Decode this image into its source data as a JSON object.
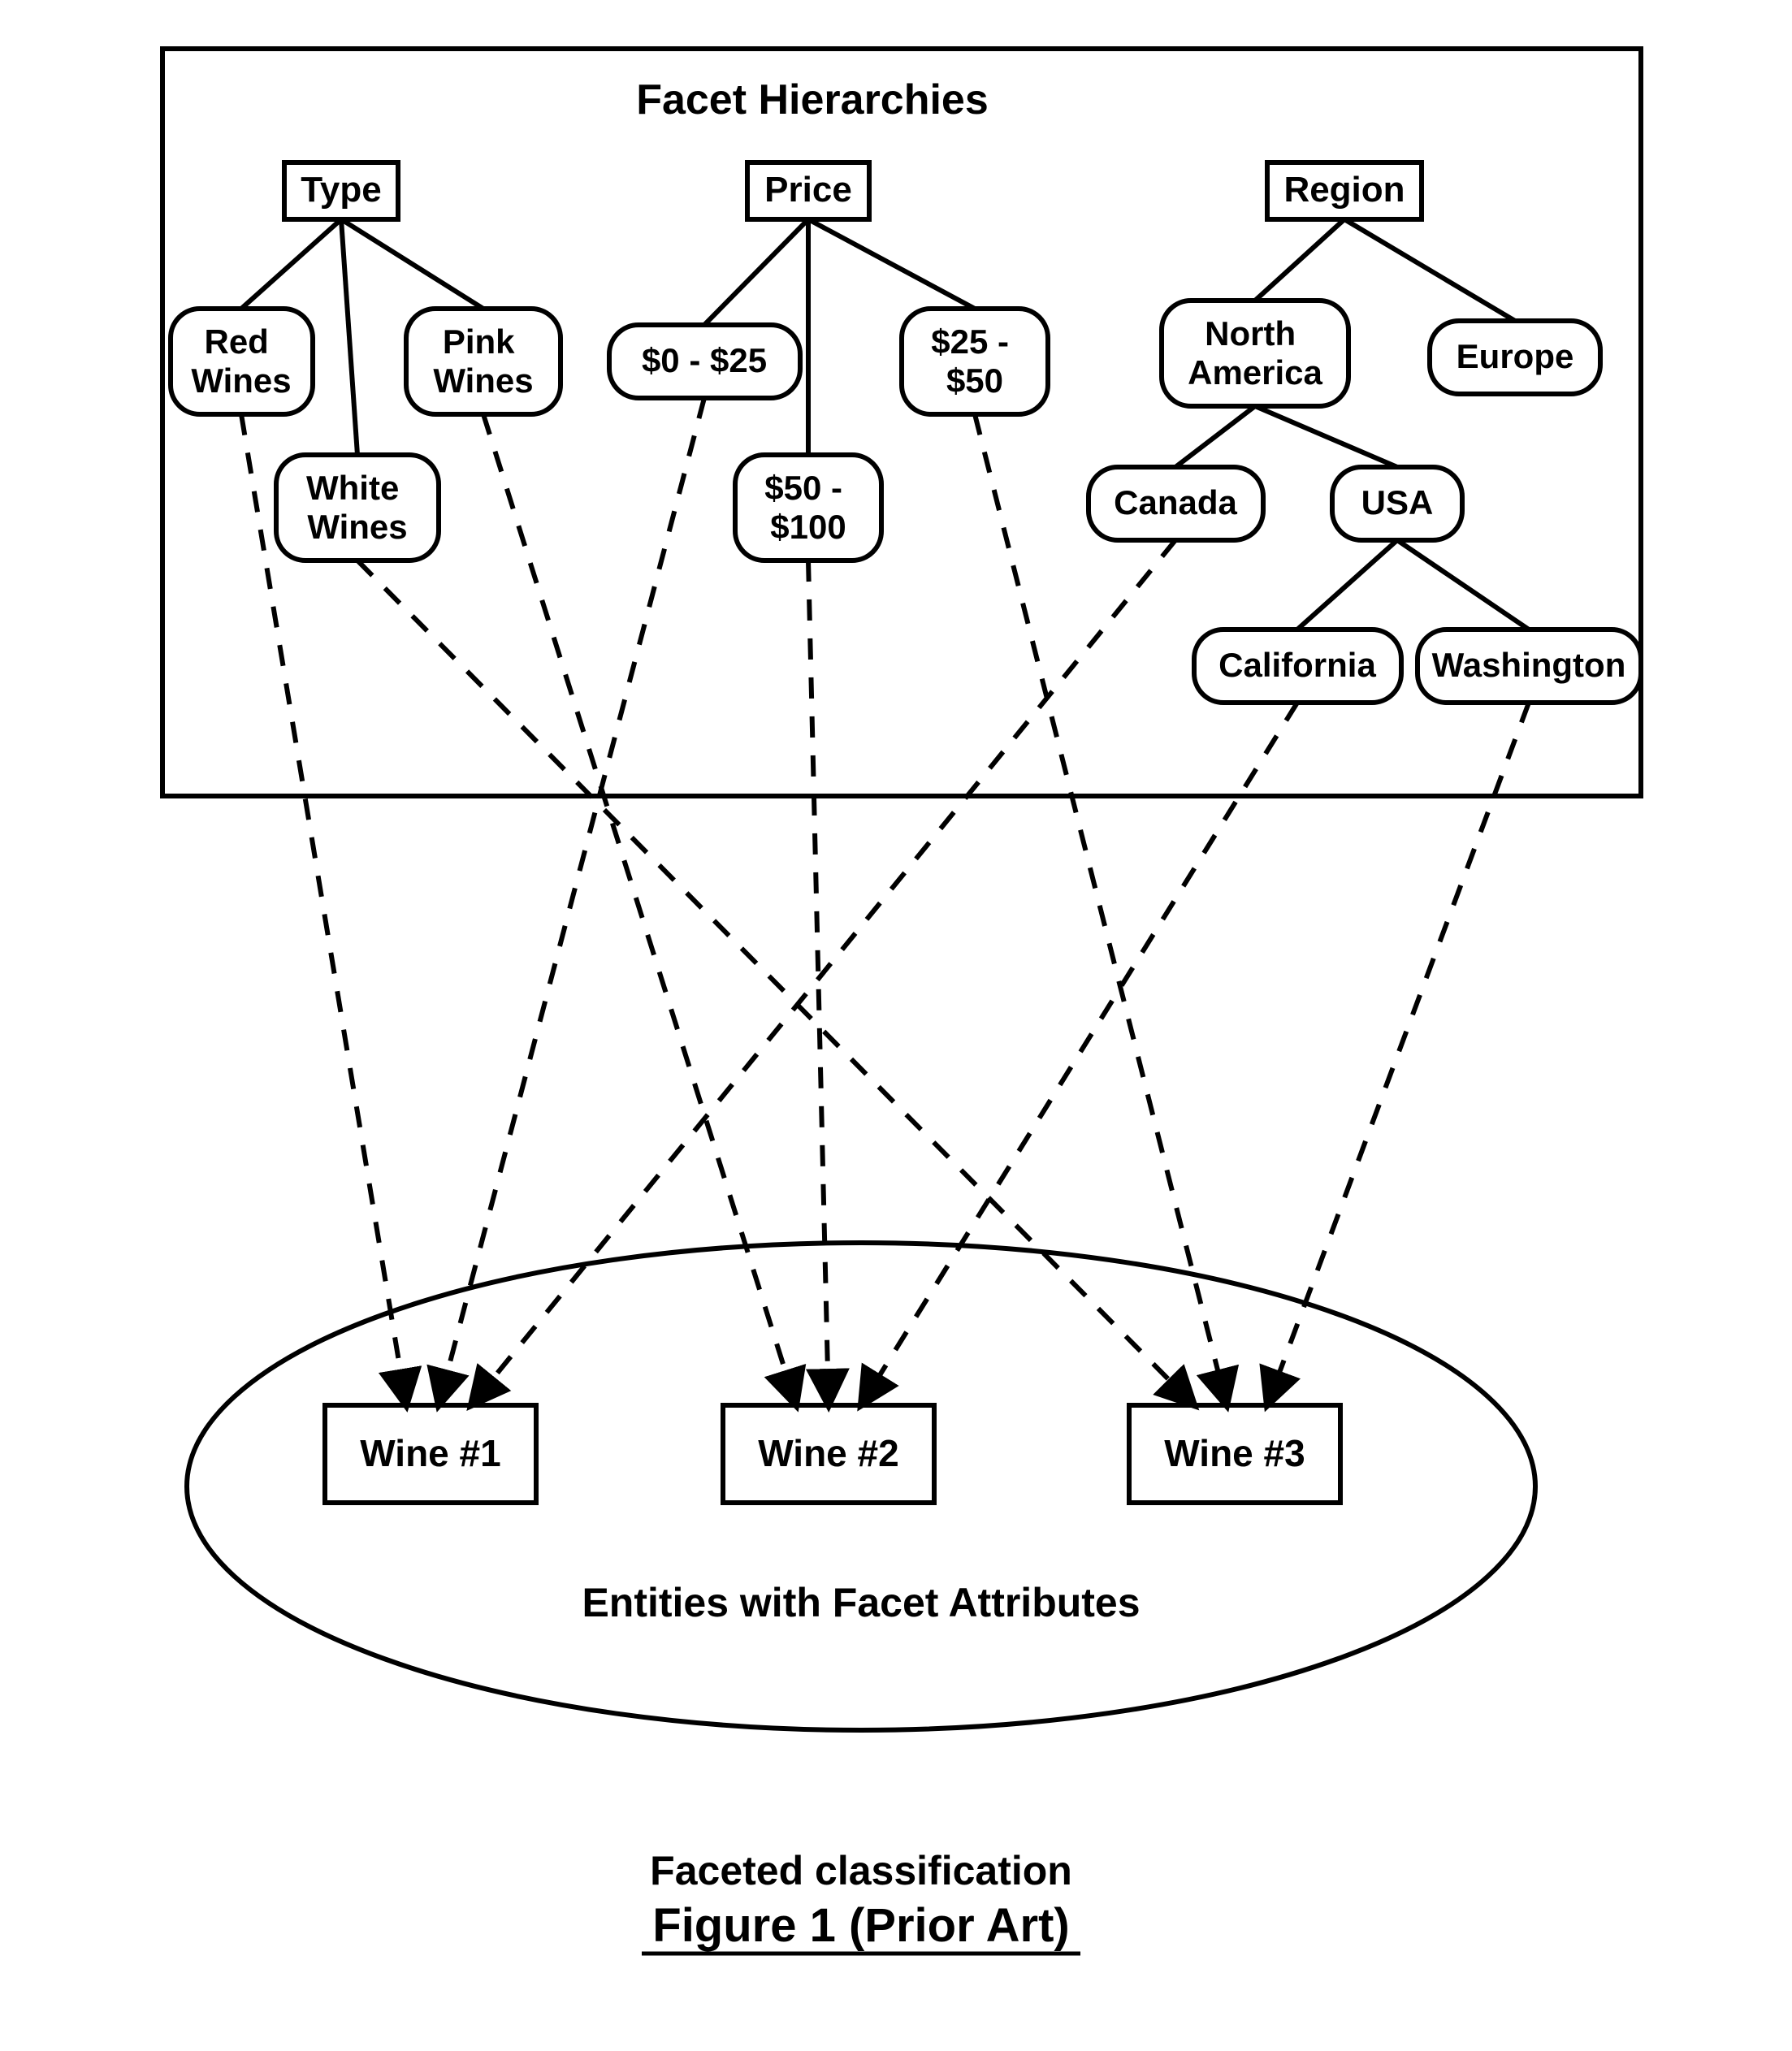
{
  "titles": {
    "hierarchies": "Facet Hierarchies",
    "entities": "Entities with Facet Attributes",
    "caption_line1": "Faceted classification",
    "caption_line2": "Figure 1 (Prior Art)"
  },
  "facets": {
    "type": {
      "label": "Type",
      "children": {
        "red": "Red\nWines",
        "white": "White\nWines",
        "pink": "Pink\nWines"
      }
    },
    "price": {
      "label": "Price",
      "children": {
        "p0": "$0 - $25",
        "p50": "$50 -\n$100",
        "p25": "$25 -\n$50"
      }
    },
    "region": {
      "label": "Region",
      "children": {
        "north_america": "North\nAmerica",
        "europe": "Europe",
        "canada": "Canada",
        "usa": "USA",
        "california": "California",
        "washington": "Washington"
      }
    }
  },
  "entities": {
    "w1": "Wine #1",
    "w2": "Wine #2",
    "w3": "Wine #3"
  }
}
